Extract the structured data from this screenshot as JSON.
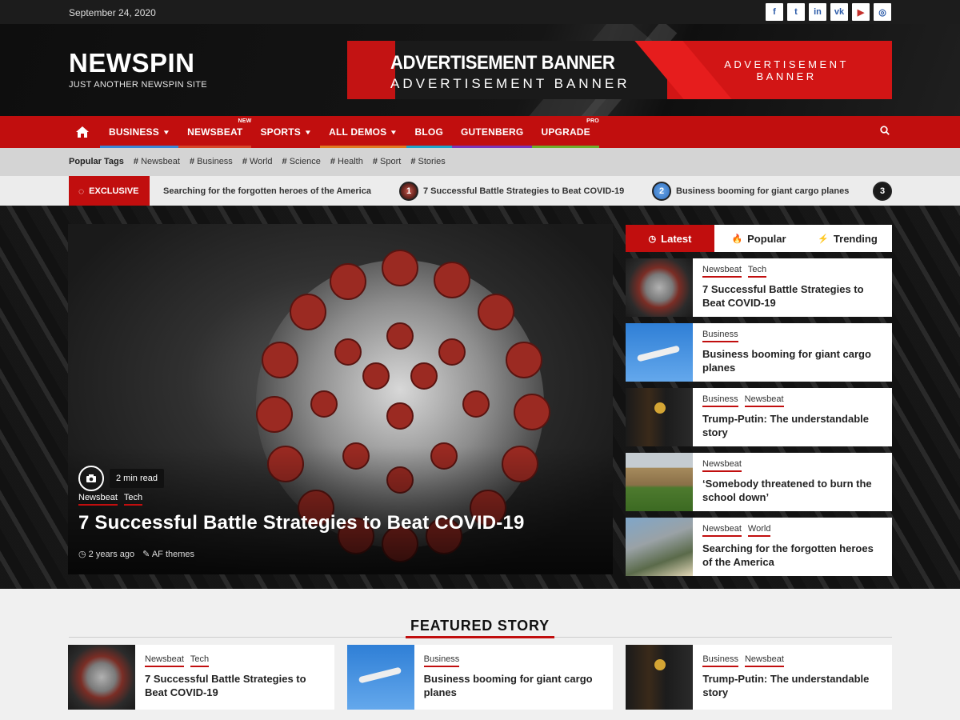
{
  "topbar": {
    "date": "September 24, 2020",
    "socials": [
      {
        "icon": "facebook-icon",
        "glyph": "f"
      },
      {
        "icon": "twitter-icon",
        "glyph": "t"
      },
      {
        "icon": "linkedin-icon",
        "glyph": "in"
      },
      {
        "icon": "vk-icon",
        "glyph": "vk"
      },
      {
        "icon": "youtube-icon",
        "glyph": "▶"
      },
      {
        "icon": "instagram-icon",
        "glyph": "◎"
      }
    ]
  },
  "header": {
    "logo": "NEWSPIN",
    "tagline": "JUST ANOTHER NEWSPIN SITE",
    "ad": {
      "line1": "ADVERTISEMENT BANNER",
      "line2": "ADVERTISEMENT BANNER",
      "line3a": "ADVERTISEMENT",
      "line3b": "BANNER"
    }
  },
  "nav": {
    "home_icon": "home-icon",
    "items": [
      {
        "label": "BUSINESS",
        "dropdown": true,
        "tag": "",
        "color": "#3a87d6"
      },
      {
        "label": "NEWSBEAT",
        "dropdown": false,
        "tag": "NEW",
        "color": "#d6452a"
      },
      {
        "label": "SPORTS",
        "dropdown": true,
        "tag": "",
        "color": "#c10e0e"
      },
      {
        "label": "ALL DEMOS",
        "dropdown": true,
        "tag": "",
        "color": "#e07a22"
      },
      {
        "label": "BLOG",
        "dropdown": false,
        "tag": "",
        "color": "#1fa4c9"
      },
      {
        "label": "GUTENBERG",
        "dropdown": false,
        "tag": "",
        "color": "#7b36b8"
      },
      {
        "label": "UPGRADE",
        "dropdown": false,
        "tag": "PRO",
        "color": "#6fae2c"
      }
    ],
    "search_icon": "search-icon"
  },
  "tags": {
    "label": "Popular Tags",
    "items": [
      "Newsbeat",
      "Business",
      "World",
      "Science",
      "Health",
      "Sport",
      "Stories"
    ]
  },
  "exclusive": {
    "label": "EXCLUSIVE",
    "items": [
      {
        "num": "",
        "title": "Searching for the forgotten heroes of the America"
      },
      {
        "num": "1",
        "title": "7 Successful Battle Strategies to Beat COVID-19"
      },
      {
        "num": "2",
        "title": "Business booming for giant cargo planes"
      },
      {
        "num": "3",
        "title": ""
      }
    ]
  },
  "main_story": {
    "read_time": "2 min read",
    "categories": [
      "Newsbeat",
      "Tech"
    ],
    "title": "7 Successful Battle Strategies to Beat COVID-19",
    "time_ago": "2 years ago",
    "author": "AF themes"
  },
  "sidebar": {
    "tabs": [
      {
        "label": "Latest",
        "icon": "clock-icon",
        "glyph": "◷"
      },
      {
        "label": "Popular",
        "icon": "fire-icon",
        "glyph": "🔥"
      },
      {
        "label": "Trending",
        "icon": "bolt-icon",
        "glyph": "⚡"
      }
    ],
    "items": [
      {
        "cats": [
          "Newsbeat",
          "Tech"
        ],
        "title": "7 Successful Battle Strategies to Beat COVID-19",
        "thumb": "t-virus"
      },
      {
        "cats": [
          "Business"
        ],
        "title": "Business booming for giant cargo planes",
        "thumb": "t-plane"
      },
      {
        "cats": [
          "Business",
          "Newsbeat"
        ],
        "title": "Trump-Putin: The understandable story",
        "thumb": "t-trump"
      },
      {
        "cats": [
          "Newsbeat"
        ],
        "title": "‘Somebody threatened to burn the school down’",
        "thumb": "t-college"
      },
      {
        "cats": [
          "Newsbeat",
          "World"
        ],
        "title": "Searching for the forgotten heroes of the America",
        "thumb": "t-hero"
      }
    ]
  },
  "featured": {
    "heading": "FEATURED STORY",
    "items": [
      {
        "cats": [
          "Newsbeat",
          "Tech"
        ],
        "title": "7 Successful Battle Strategies to Beat COVID-19",
        "thumb": "t-virus"
      },
      {
        "cats": [
          "Business"
        ],
        "title": "Business booming for giant cargo planes",
        "thumb": "t-plane"
      },
      {
        "cats": [
          "Business",
          "Newsbeat"
        ],
        "title": "Trump-Putin: The understandable story",
        "thumb": "t-trump"
      }
    ]
  },
  "colors": {
    "accent": "#c10e0e",
    "dark": "#1c1c1c"
  }
}
